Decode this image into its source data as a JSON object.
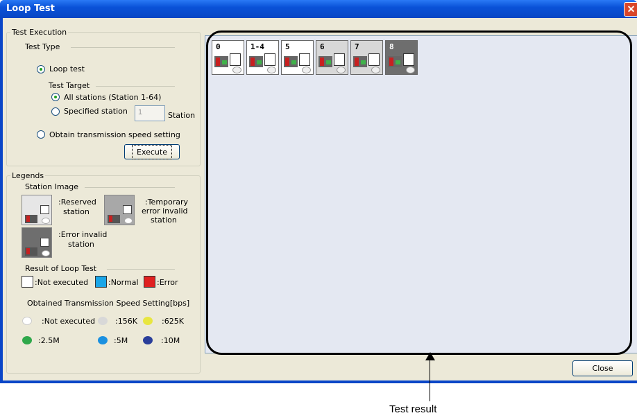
{
  "window": {
    "title": "Loop Test",
    "close_glyph": "✕"
  },
  "test_execution": {
    "group_title": "Test Execution",
    "test_type_title": "Test Type",
    "loop_test_label": "Loop test",
    "test_target_title": "Test Target",
    "all_stations_label": "All stations (Station 1-64)",
    "specified_station_label": "Specified station",
    "station_value": "1",
    "station_unit": "Station",
    "obtain_speed_label": "Obtain transmission speed setting",
    "execute_button": "Execute",
    "selected_type": "Loop test",
    "selected_target": "All stations (Station 1-64)"
  },
  "legends": {
    "group_title": "Legends",
    "station_image_title": "Station Image",
    "reserved": ":Reserved\nstation",
    "reserved_line1": ":Reserved",
    "reserved_line2": "station",
    "temp_line1": ":Temporary",
    "temp_line2": "error invalid",
    "temp_line3": "station",
    "err_line1": ":Error invalid",
    "err_line2": "station",
    "result_title": "Result of Loop Test",
    "not_executed": ":Not executed",
    "normal": ":Normal",
    "error": ":Error",
    "speed_title": "Obtained Transmission Speed Setting[bps]",
    "speed_not_executed": ":Not executed",
    "speed_156k": ":156K",
    "speed_625k": ":625K",
    "speed_2_5m": ":2.5M",
    "speed_5m": ":5M",
    "speed_10m": ":10M",
    "colors": {
      "normal": "#1aa6e8",
      "error": "#e02020",
      "625k": "#e8e640",
      "2_5m": "#2fa84a",
      "5m": "#1a90e0",
      "10m": "#2a3e9a"
    }
  },
  "result_panel": {
    "stations": [
      {
        "label": "0",
        "bg": "#ffffff"
      },
      {
        "label": "1-4",
        "bg": "#ffffff"
      },
      {
        "label": "5",
        "bg": "#ffffff"
      },
      {
        "label": "6",
        "bg": "#d8d8d8"
      },
      {
        "label": "7",
        "bg": "#d8d8d8"
      },
      {
        "label": "8",
        "bg": "#6e6e6e"
      }
    ]
  },
  "footer": {
    "close_button": "Close"
  },
  "annotation": {
    "caption": "Test result"
  }
}
